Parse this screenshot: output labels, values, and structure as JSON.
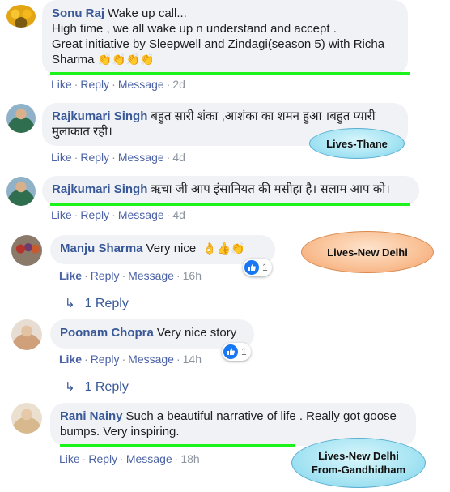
{
  "comments": [
    {
      "author": "Sonu Raj",
      "first_line": "Wake up call...",
      "lines": [
        "High time , we all wake up n understand and accept .",
        "Great initiative by Sleepwell and Zindagi(season 5) with Richa"
      ],
      "last_line": "Sharma",
      "emoji": "👏👏👏👏",
      "like": "Like",
      "reply": "Reply",
      "message": "Message",
      "time": "2d"
    },
    {
      "author": "Rajkumari Singh",
      "line1": "बहुत सारी शंका ,आशंका का शमन हुआ ।बहुत प्यारी",
      "line2": "मुलाकात रही।",
      "like": "Like",
      "reply": "Reply",
      "message": "Message",
      "time": "4d"
    },
    {
      "author": "Rajkumari Singh",
      "text": "ऋचा जी आप इंसानियत की मसीहा है। सलाम आप को।",
      "like": "Like",
      "reply": "Reply",
      "message": "Message",
      "time": "4d"
    },
    {
      "author": "Manju Sharma",
      "text": "Very nice",
      "emoji": "👌👍👏",
      "reaction_count": "1",
      "like": "Like",
      "reply": "Reply",
      "message": "Message",
      "time": "16h",
      "replies": "1 Reply"
    },
    {
      "author": "Poonam Chopra",
      "text": "Very nice story",
      "reaction_count": "1",
      "like": "Like",
      "reply": "Reply",
      "message": "Message",
      "time": "14h",
      "replies": "1 Reply"
    },
    {
      "author": "Rani Nainy",
      "line1": "Such a beautiful narrative of life . Really got goose",
      "line2": "bumps. Very inspiring.",
      "like": "Like",
      "reply": "Reply",
      "message": "Message",
      "time": "18h"
    }
  ],
  "callouts": {
    "thane": "Lives-Thane",
    "delhi": "Lives-New Delhi",
    "gandhidham_1": "Lives-New Delhi",
    "gandhidham_2": "From-Gandhidham"
  },
  "colors": {
    "highlight": "#1bf31b",
    "link": "#385898",
    "bubble": "#f0f2f5"
  },
  "icons": {
    "reaction": "like-reaction-icon",
    "reply_arrow": "reply-arrow-icon"
  }
}
